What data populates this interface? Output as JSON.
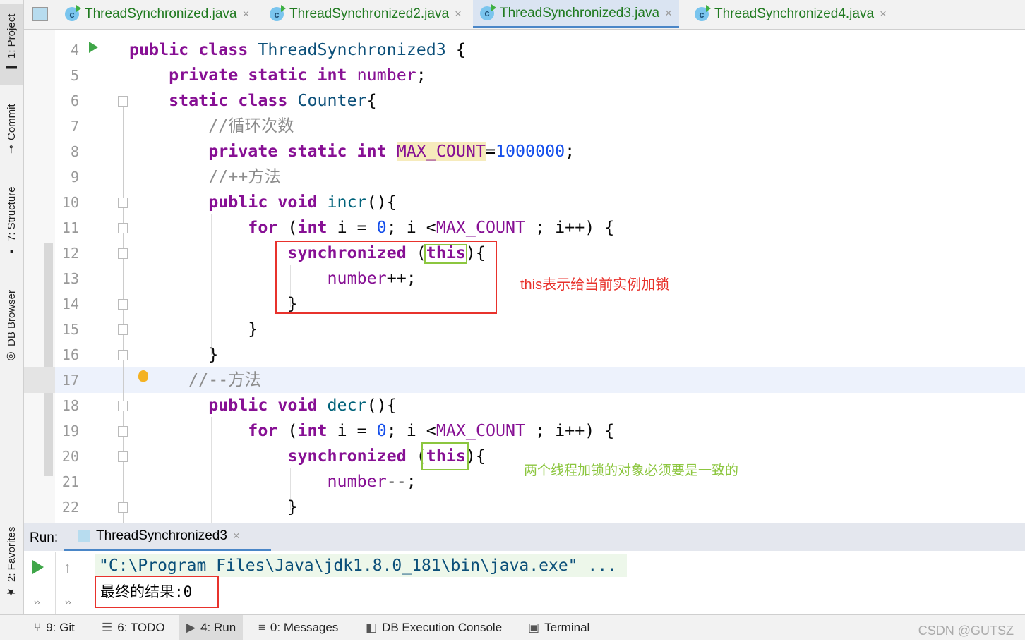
{
  "left_tools": [
    {
      "label": "1: Project",
      "icon": "folder-icon"
    },
    {
      "label": "Commit",
      "icon": "commit-icon"
    },
    {
      "label": "7: Structure",
      "icon": "structure-icon"
    },
    {
      "label": "DB Browser",
      "icon": "db-browser-icon"
    },
    {
      "label": "2: Favorites",
      "icon": "star-icon"
    }
  ],
  "tabs": [
    {
      "label": "ThreadSynchronized.java"
    },
    {
      "label": "ThreadSynchronized2.java"
    },
    {
      "label": "ThreadSynchronized3.java",
      "active": true
    },
    {
      "label": "ThreadSynchronized4.java"
    }
  ],
  "code": [
    {
      "n": "4",
      "t": [
        [
          "public ",
          "kw"
        ],
        [
          "class ",
          "kw"
        ],
        [
          "ThreadSynchronized3 ",
          "cls"
        ],
        [
          "{",
          "p"
        ]
      ]
    },
    {
      "n": "5",
      "t": [
        [
          "    private ",
          "kw"
        ],
        [
          "static ",
          "kw"
        ],
        [
          "int ",
          "kw"
        ],
        [
          "number",
          "fld"
        ],
        [
          ";",
          "p"
        ]
      ]
    },
    {
      "n": "6",
      "t": [
        [
          "    static ",
          "kw"
        ],
        [
          "class ",
          "kw"
        ],
        [
          "Counter",
          "cls"
        ],
        [
          "{",
          "p"
        ]
      ]
    },
    {
      "n": "7",
      "t": [
        [
          "        //循环次数",
          "cm"
        ]
      ]
    },
    {
      "n": "8",
      "t": [
        [
          "        private ",
          "kw"
        ],
        [
          "static ",
          "kw"
        ],
        [
          "int ",
          "kw"
        ],
        [
          "MAX_COUNT",
          "hl"
        ],
        [
          "=",
          "p"
        ],
        [
          "1000000",
          "num"
        ],
        [
          ";",
          "p"
        ]
      ]
    },
    {
      "n": "9",
      "t": [
        [
          "        //++方法",
          "cm"
        ]
      ]
    },
    {
      "n": "10",
      "t": [
        [
          "        public ",
          "kw"
        ],
        [
          "void ",
          "kw"
        ],
        [
          "incr",
          "fn"
        ],
        [
          "(){",
          "p"
        ]
      ]
    },
    {
      "n": "11",
      "t": [
        [
          "            for ",
          "kw"
        ],
        [
          "(",
          "p"
        ],
        [
          "int ",
          "kw"
        ],
        [
          "i = ",
          "p"
        ],
        [
          "0",
          "num"
        ],
        [
          "; i <",
          "p"
        ],
        [
          "MAX_COUNT",
          "fld"
        ],
        [
          " ; i++) {",
          "p"
        ]
      ]
    },
    {
      "n": "12",
      "t": [
        [
          "                synchronized ",
          "kw"
        ],
        [
          "(",
          "p"
        ],
        [
          "this",
          "kw"
        ],
        [
          "){",
          "p"
        ]
      ]
    },
    {
      "n": "13",
      "t": [
        [
          "                    number",
          "fld"
        ],
        [
          "++;",
          "p"
        ]
      ]
    },
    {
      "n": "14",
      "t": [
        [
          "                }",
          "p"
        ]
      ]
    },
    {
      "n": "15",
      "t": [
        [
          "            }",
          "p"
        ]
      ]
    },
    {
      "n": "16",
      "t": [
        [
          "        }",
          "p"
        ]
      ]
    },
    {
      "n": "17",
      "t": [
        [
          "      //--方法",
          "cm"
        ]
      ]
    },
    {
      "n": "18",
      "t": [
        [
          "        public ",
          "kw"
        ],
        [
          "void ",
          "kw"
        ],
        [
          "decr",
          "fn"
        ],
        [
          "(){",
          "p"
        ]
      ]
    },
    {
      "n": "19",
      "t": [
        [
          "            for ",
          "kw"
        ],
        [
          "(",
          "p"
        ],
        [
          "int ",
          "kw"
        ],
        [
          "i = ",
          "p"
        ],
        [
          "0",
          "num"
        ],
        [
          "; i <",
          "p"
        ],
        [
          "MAX_COUNT",
          "fld"
        ],
        [
          " ; i++) {",
          "p"
        ]
      ]
    },
    {
      "n": "20",
      "t": [
        [
          "                synchronized ",
          "kw"
        ],
        [
          "(",
          "p"
        ],
        [
          "this",
          "kw"
        ],
        [
          "){",
          "p"
        ]
      ]
    },
    {
      "n": "21",
      "t": [
        [
          "                    number",
          "fld"
        ],
        [
          "--;",
          "p"
        ]
      ]
    },
    {
      "n": "22",
      "t": [
        [
          "                }",
          "p"
        ]
      ]
    }
  ],
  "annotations": {
    "red": "this表示给当前实例加锁",
    "green": "两个线程加锁的对象必须要是一致的",
    "red_color": "#e8322c",
    "green_color": "#8cc63f"
  },
  "run": {
    "label": "Run:",
    "tab": "ThreadSynchronized3",
    "cmd": "\"C:\\Program Files\\Java\\jdk1.8.0_181\\bin\\java.exe\" ...",
    "output": "最终的结果:0"
  },
  "bottom": [
    {
      "label": "9: Git",
      "icon": "git-icon"
    },
    {
      "label": "6: TODO",
      "icon": "list-icon"
    },
    {
      "label": "4: Run",
      "icon": "run-icon"
    },
    {
      "label": "0: Messages",
      "icon": "messages-icon"
    },
    {
      "label": "DB Execution Console",
      "icon": "db-console-icon"
    },
    {
      "label": "Terminal",
      "icon": "terminal-icon"
    }
  ],
  "watermark": "CSDN @GUTSZ"
}
